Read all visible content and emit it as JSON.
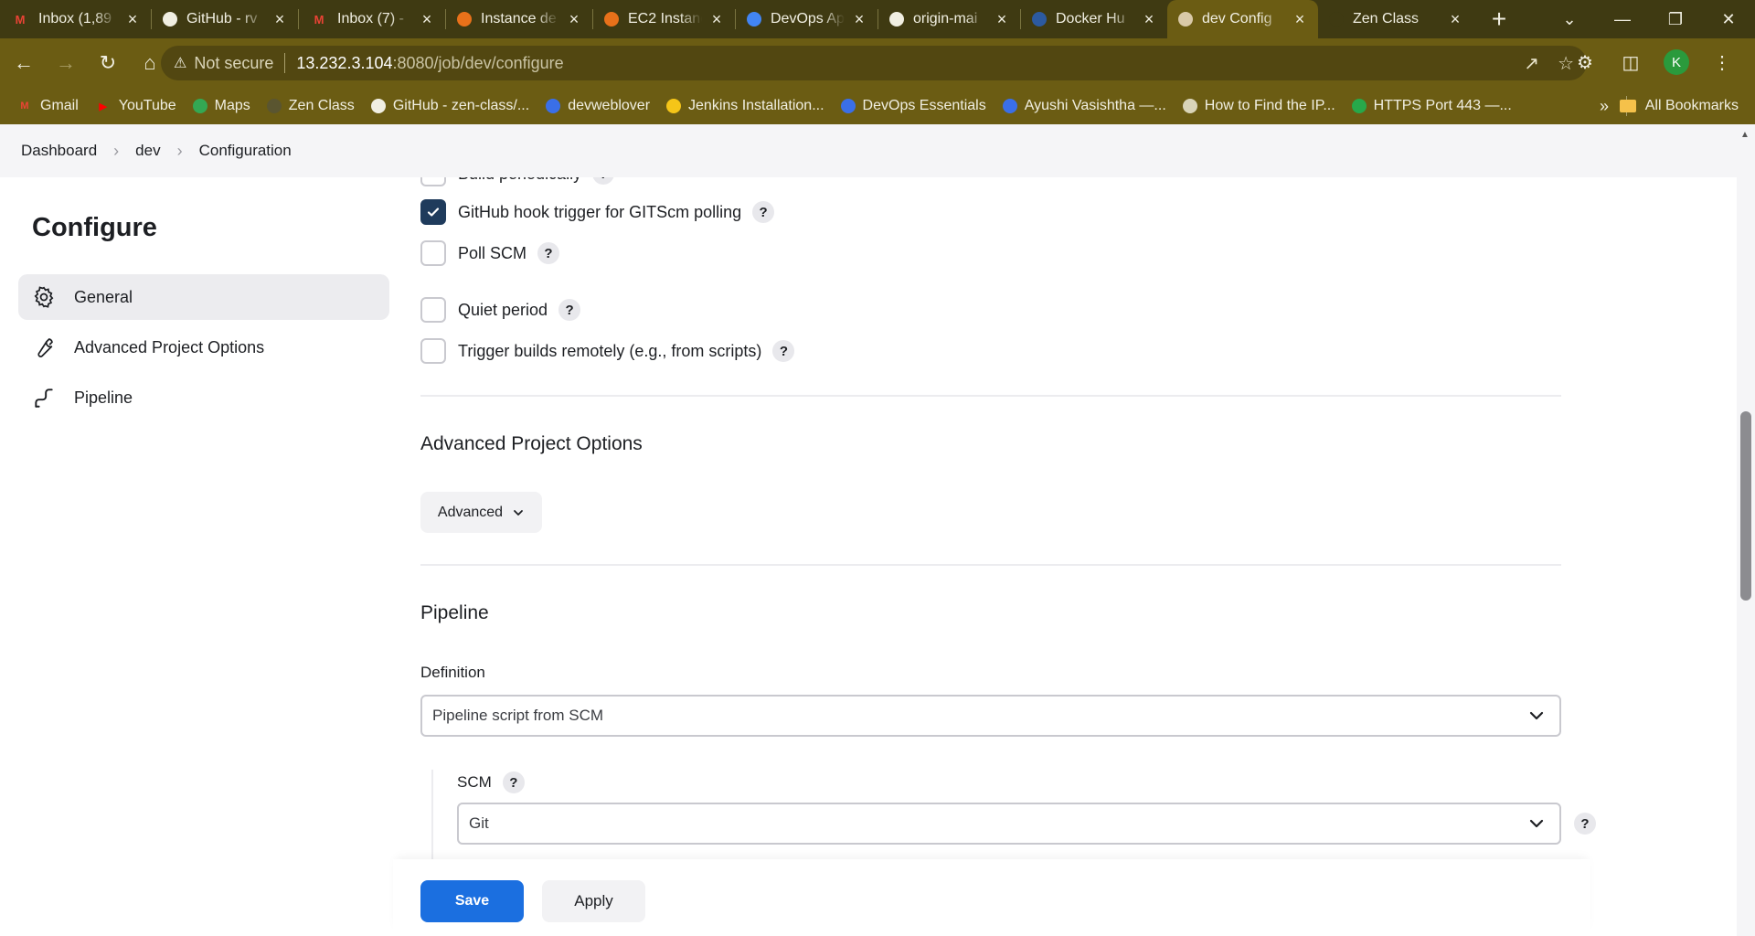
{
  "browser": {
    "tabs": [
      {
        "title": "Inbox (1,89",
        "icon": "gmail-icon",
        "icon_color": "#ea4335",
        "icon_text": "M"
      },
      {
        "title": "GitHub - rv",
        "icon": "github-icon",
        "icon_color": "#f1efe2",
        "icon_text": ""
      },
      {
        "title": "Inbox (7) -",
        "icon": "gmail-icon",
        "icon_color": "#ea4335",
        "icon_text": "M"
      },
      {
        "title": "Instance de",
        "icon": "aws-icon",
        "icon_color": "#e8711a",
        "icon_text": ""
      },
      {
        "title": "EC2 Instanc",
        "icon": "aws-ec2-icon",
        "icon_color": "#e8711a",
        "icon_text": ""
      },
      {
        "title": "DevOps Ap",
        "icon": "docs-icon",
        "icon_color": "#4285f4",
        "icon_text": ""
      },
      {
        "title": "origin-mai",
        "icon": "github-icon",
        "icon_color": "#f1efe2",
        "icon_text": ""
      },
      {
        "title": "Docker Hu",
        "icon": "docker-icon",
        "icon_color": "#2c5aa0",
        "icon_text": ""
      },
      {
        "title": "dev Config",
        "icon": "jenkins-icon",
        "icon_color": "#d9c9a8",
        "icon_text": "",
        "active": true
      },
      {
        "title": "Zen Class",
        "icon": "zen-icon",
        "icon_color": "#3f3a12",
        "icon_text": ""
      }
    ],
    "url": {
      "security_label": "Not secure",
      "host": "13.232.3.104",
      "path": ":8080/job/dev/configure"
    },
    "profile_initial": "K",
    "bookmarks": [
      {
        "label": "Gmail",
        "icon": "gmail-icon",
        "color": "#ea4335",
        "text": "M"
      },
      {
        "label": "YouTube",
        "icon": "youtube-icon",
        "color": "#ff0000",
        "text": "▶"
      },
      {
        "label": "Maps",
        "icon": "maps-icon",
        "color": "#34a853",
        "text": ""
      },
      {
        "label": "Zen Class",
        "icon": "zen-icon",
        "color": "#5a5530",
        "text": ""
      },
      {
        "label": "GitHub - zen-class/...",
        "icon": "github-icon",
        "color": "#f1efe2",
        "text": ""
      },
      {
        "label": "devweblover",
        "icon": "devweblover-icon",
        "color": "#3a6fe8",
        "text": ""
      },
      {
        "label": "Jenkins Installation...",
        "icon": "jenkins-icon",
        "color": "#f5c518",
        "text": ""
      },
      {
        "label": "DevOps Essentials",
        "icon": "devops-icon",
        "color": "#3a6fe8",
        "text": ""
      },
      {
        "label": "Ayushi Vasishtha —...",
        "icon": "hashnode-icon",
        "color": "#3a6fe8",
        "text": ""
      },
      {
        "label": "How to Find the IP...",
        "icon": "site-icon",
        "color": "#d9d4b8",
        "text": ""
      },
      {
        "label": "HTTPS Port 443 —...",
        "icon": "ssl-icon",
        "color": "#27a84a",
        "text": ""
      }
    ],
    "all_bookmarks_label": "All Bookmarks"
  },
  "breadcrumb": {
    "items": [
      "Dashboard",
      "dev",
      "Configuration"
    ]
  },
  "sidebar": {
    "title": "Configure",
    "items": [
      {
        "label": "General",
        "icon": "gear-icon",
        "active": true
      },
      {
        "label": "Advanced Project Options",
        "icon": "wrench-icon",
        "active": false
      },
      {
        "label": "Pipeline",
        "icon": "pipeline-icon",
        "active": false
      }
    ]
  },
  "triggers": {
    "build_periodically": {
      "label": "Build periodically",
      "checked": false
    },
    "github_hook": {
      "label": "GitHub hook trigger for GITScm polling",
      "checked": true
    },
    "poll_scm": {
      "label": "Poll SCM",
      "checked": false
    },
    "quiet_period": {
      "label": "Quiet period",
      "checked": false
    },
    "trigger_remote": {
      "label": "Trigger builds remotely (e.g., from scripts)",
      "checked": false
    }
  },
  "advanced_section": {
    "title": "Advanced Project Options",
    "button_label": "Advanced"
  },
  "pipeline_section": {
    "title": "Pipeline",
    "definition_label": "Definition",
    "definition_value": "Pipeline script from SCM",
    "scm_label": "SCM",
    "scm_value": "Git"
  },
  "actions": {
    "save_label": "Save",
    "apply_label": "Apply"
  },
  "colors": {
    "chrome_bg": "#6b5c13",
    "primary_button": "#1b6fe0",
    "checkbox_checked": "#1f3b5c"
  }
}
